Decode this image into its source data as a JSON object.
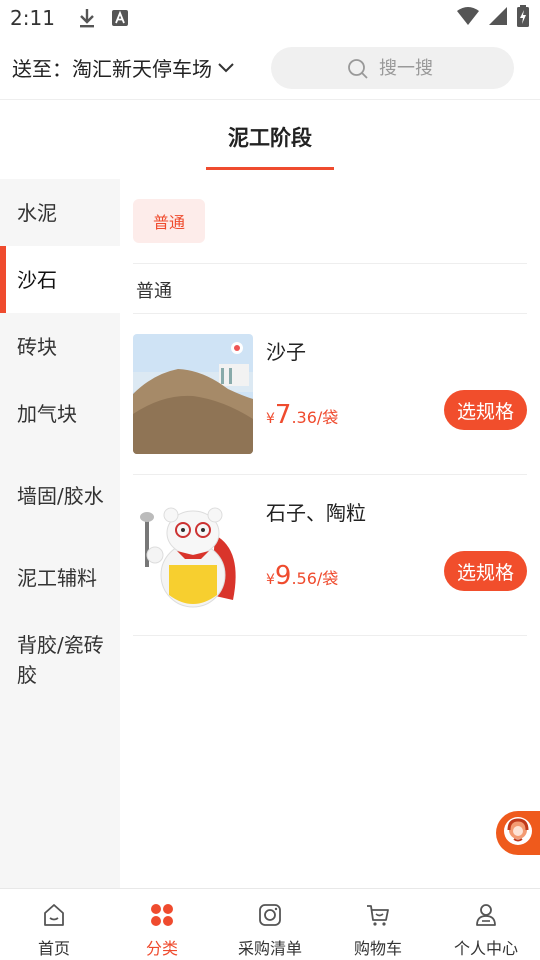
{
  "status_bar": {
    "time": "2:11",
    "icons": [
      "download-icon",
      "text-a-icon",
      "wifi-icon",
      "signal-icon",
      "battery-charging-icon"
    ]
  },
  "header": {
    "location_prefix": "送至：",
    "location_name": "淘汇新天停车场",
    "search_placeholder": "搜一搜"
  },
  "stage": {
    "title": "泥工阶段"
  },
  "sidebar": {
    "items": [
      {
        "label": "水泥"
      },
      {
        "label": "沙石"
      },
      {
        "label": "砖块"
      },
      {
        "label": "加气块"
      },
      {
        "label": "墙固/胶水"
      },
      {
        "label": "泥工辅料"
      },
      {
        "label": "背胶/瓷砖胶"
      }
    ],
    "active_index": 1
  },
  "filter": {
    "chip_label": "普通",
    "section_label": "普通"
  },
  "products": [
    {
      "name": "沙子",
      "currency": "¥",
      "price_int": "7",
      "price_rest": ".36/袋",
      "button": "选规格",
      "image": "sand-pile-image"
    },
    {
      "name": "石子、陶粒",
      "currency": "¥",
      "price_int": "9",
      "price_rest": ".56/袋",
      "button": "选规格",
      "image": "bear-mascot-image"
    }
  ],
  "bottom_nav": {
    "items": [
      {
        "label": "首页",
        "icon": "home-icon"
      },
      {
        "label": "分类",
        "icon": "category-icon"
      },
      {
        "label": "采购清单",
        "icon": "purchase-list-icon"
      },
      {
        "label": "购物车",
        "icon": "cart-icon"
      },
      {
        "label": "个人中心",
        "icon": "profile-icon"
      }
    ],
    "active_index": 1
  },
  "colors": {
    "accent": "#ef4b2e",
    "chip_bg": "#fdecea",
    "sidebar_bg": "#f6f6f6",
    "search_bg": "#f0f0f0"
  }
}
